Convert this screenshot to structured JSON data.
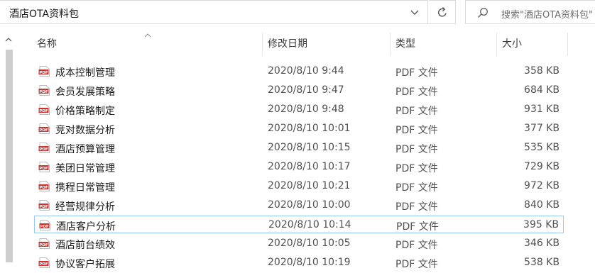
{
  "address": {
    "path": "酒店OTA资料包",
    "search_placeholder": "搜索\"酒店OTA资料包\""
  },
  "columns": {
    "name": "名称",
    "date": "修改日期",
    "type": "类型",
    "size": "大小"
  },
  "files": [
    {
      "name": "成本控制管理",
      "date": "2020/8/10 9:44",
      "type": "PDF 文件",
      "size": "358 KB"
    },
    {
      "name": "会员发展策略",
      "date": "2020/8/10 9:47",
      "type": "PDF 文件",
      "size": "684 KB"
    },
    {
      "name": "价格策略制定",
      "date": "2020/8/10 9:48",
      "type": "PDF 文件",
      "size": "931 KB"
    },
    {
      "name": "竞对数据分析",
      "date": "2020/8/10 10:01",
      "type": "PDF 文件",
      "size": "377 KB"
    },
    {
      "name": "酒店预算管理",
      "date": "2020/8/10 10:15",
      "type": "PDF 文件",
      "size": "535 KB"
    },
    {
      "name": "美团日常管理",
      "date": "2020/8/10 10:17",
      "type": "PDF 文件",
      "size": "729 KB"
    },
    {
      "name": "携程日常管理",
      "date": "2020/8/10 10:21",
      "type": "PDF 文件",
      "size": "972 KB"
    },
    {
      "name": "经营规律分析",
      "date": "2020/8/10 10:00",
      "type": "PDF 文件",
      "size": "840 KB"
    },
    {
      "name": "酒店客户分析",
      "date": "2020/8/10 10:14",
      "type": "PDF 文件",
      "size": "395 KB"
    },
    {
      "name": "酒店前台绩效",
      "date": "2020/8/10 10:05",
      "type": "PDF 文件",
      "size": "346 KB"
    },
    {
      "name": "协议客户拓展",
      "date": "2020/8/10 10:19",
      "type": "PDF 文件",
      "size": "538 KB"
    }
  ],
  "selected_index": 8,
  "icons": {
    "file": "pdf-icon",
    "refresh": "refresh-icon",
    "search": "search-icon",
    "dropdown": "chevron-down-icon",
    "sort": "sort-ascending-icon"
  },
  "colors": {
    "pdf_red": "#d2322d",
    "selection_border": "#99c9ef"
  }
}
